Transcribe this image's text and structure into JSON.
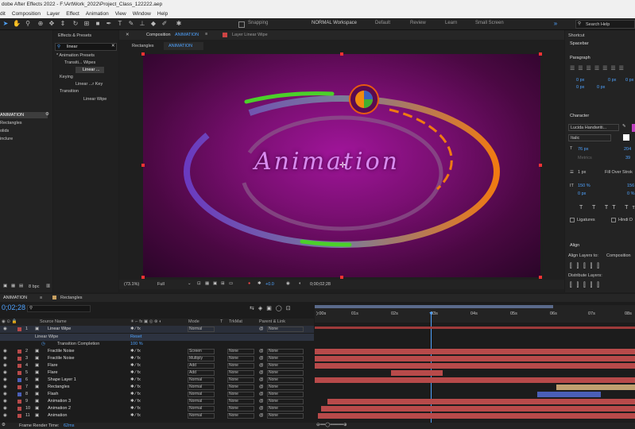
{
  "app": {
    "title": "dobe After Effects 2022 - F:\\ArtWork_2022\\Project_Class_122222.aep"
  },
  "menu": [
    "dit",
    "Composition",
    "Layer",
    "Effect",
    "Animation",
    "View",
    "Window",
    "Help"
  ],
  "toolbar": {
    "snapping": "Snapping",
    "workspaces": [
      "NORMAL Workspace",
      "Default",
      "Review",
      "Learn",
      "Small Screen"
    ],
    "search_placeholder": "Search Help"
  },
  "effects": {
    "tab": "Effects & Presets",
    "search": "linear",
    "tree": [
      "* Animation Presets",
      "Transiti... Wipes",
      "Linear ...",
      "Keying",
      "Linear ...r Key",
      "Transition",
      "Linear Wipe"
    ]
  },
  "project": {
    "items": [
      "ANIMATION",
      "Rectangles",
      "olids",
      "inclure"
    ],
    "bpc": "8 bpc"
  },
  "comp": {
    "tab": "Composition",
    "tab_name": "ANIMATION",
    "layer_tab": "Layer  Linear Wipe",
    "breadcrumbs": [
      "Rectangles",
      "ANIMATION"
    ],
    "text": "Animation",
    "zoom": "(73.1%)",
    "quality": "Full",
    "exposure": "+0.0",
    "timecode": "0;00;02;28",
    "accent": "#d88cf0"
  },
  "right": {
    "shortcut_label": "Shortcut",
    "shortcut_value": "Spacebar",
    "paragraph": "Paragraph",
    "para_vals": [
      "0 px",
      "0 px",
      "0 px",
      "0 px",
      "0 px"
    ],
    "character": "Character",
    "font": "Lucida Handwriti...",
    "style": "Italic",
    "size": "76 px",
    "leading": "204",
    "kerning": "Metrics",
    "tracking": "39",
    "stroke": "1 px",
    "stroke_type": "Fill Over Strok",
    "vscale": "150 %",
    "hscale": "156",
    "baseline": "0 px",
    "tsume": "0 %",
    "ligatures": "Ligatures",
    "hindi": "Hindi D",
    "align": "Align",
    "align_to": "Align Layers to:",
    "align_to_value": "Composition",
    "distribute": "Distribute Layers:"
  },
  "timeline": {
    "tab": "ANIMATION",
    "tab2": "Rectangles",
    "timecode": "0;02;28",
    "cols": {
      "name": "Source Name",
      "mode": "Mode",
      "t": "T",
      "trkmat": "TrkMat",
      "parent": "Parent & Link"
    },
    "effect_name": "Linear Wipe",
    "reset": "Reset",
    "prop": "Transition Completion",
    "prop_val": "100 %",
    "ruler": [
      "):00s",
      "01s",
      "02s",
      "03s",
      "04s",
      "05s",
      "06s",
      "07s",
      "08s"
    ],
    "layers": [
      {
        "n": "1",
        "name": "Linear Wipe",
        "mode": "Normal",
        "trk": "",
        "parent": "None",
        "color": "#b84a4a"
      },
      {
        "n": "2",
        "name": "Fractile Noise",
        "mode": "Screen",
        "trk": "None",
        "parent": "None",
        "color": "#b84a4a"
      },
      {
        "n": "3",
        "name": "Fractile Noise",
        "mode": "Multiply",
        "trk": "None",
        "parent": "None",
        "color": "#b84a4a"
      },
      {
        "n": "4",
        "name": "Flare",
        "mode": "Add",
        "trk": "None",
        "parent": "None",
        "color": "#b84a4a"
      },
      {
        "n": "5",
        "name": "Flare",
        "mode": "Add",
        "trk": "None",
        "parent": "None",
        "color": "#b84a4a"
      },
      {
        "n": "6",
        "name": "Shape Layer 1",
        "mode": "Normal",
        "trk": "None",
        "parent": "None",
        "color": "#4a5fb8"
      },
      {
        "n": "7",
        "name": "Rectangles",
        "mode": "Normal",
        "trk": "None",
        "parent": "None",
        "color": "#b84a4a"
      },
      {
        "n": "8",
        "name": "Flash",
        "mode": "Normal",
        "trk": "None",
        "parent": "None",
        "color": "#4a5fb8"
      },
      {
        "n": "9",
        "name": "Animation 3",
        "mode": "Normal",
        "trk": "None",
        "parent": "None",
        "color": "#b84a4a"
      },
      {
        "n": "10",
        "name": "Animation 2",
        "mode": "Normal",
        "trk": "None",
        "parent": "None",
        "color": "#b84a4a"
      },
      {
        "n": "11",
        "name": "Animation",
        "mode": "Normal",
        "trk": "None",
        "parent": "None",
        "color": "#b84a4a"
      }
    ],
    "footer": "Frame Render Time:",
    "render_time": "62ms"
  }
}
